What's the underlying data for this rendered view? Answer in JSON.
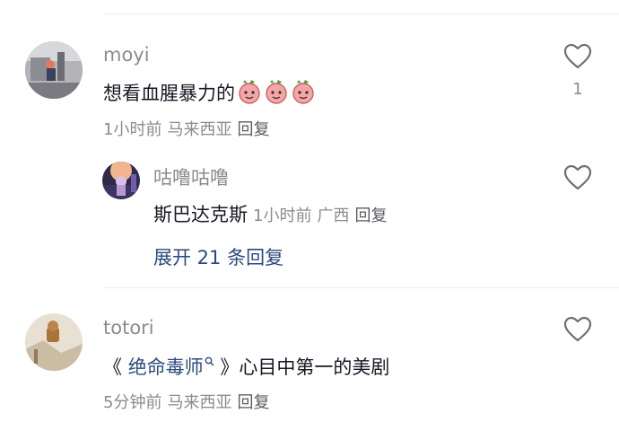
{
  "comments": [
    {
      "username": "moyi",
      "text": "想看血腥暴力的",
      "emoji_icons": [
        "peach-face-emoji",
        "peach-face-emoji",
        "peach-face-emoji"
      ],
      "time": "1小时前",
      "location": "马来西亚",
      "reply_label": "回复",
      "likes": "1",
      "replies": [
        {
          "username": "咕噜咕噜",
          "text": "斯巴达克斯",
          "time": "1小时前",
          "location": "广西",
          "reply_label": "回复"
        }
      ],
      "expand_label": "展开 21 条回复"
    },
    {
      "username": "totori",
      "text_prefix": "《",
      "link_text": "绝命毒师",
      "text_suffix": "》心目中第一的美剧",
      "time": "5分钟前",
      "location": "马来西亚",
      "reply_label": "回复"
    }
  ],
  "colors": {
    "link": "#2b4a7e",
    "meta": "#8a8b91",
    "text": "#161823",
    "divider": "#ececec"
  }
}
